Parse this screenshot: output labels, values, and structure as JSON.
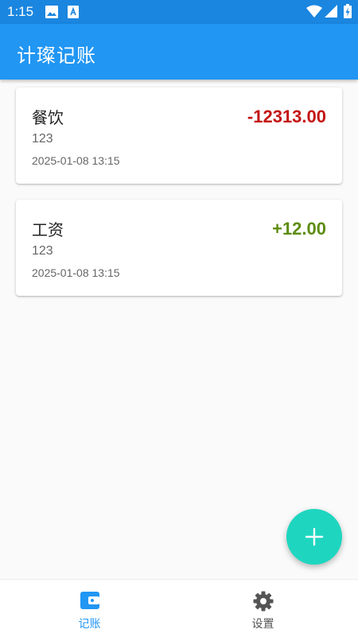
{
  "status_bar": {
    "time": "1:15"
  },
  "app_bar": {
    "title": "计璨记账"
  },
  "records": [
    {
      "category": "餐饮",
      "note": "123",
      "datetime": "2025-01-08 13:15",
      "amount": "-12313.00",
      "type": "expense"
    },
    {
      "category": "工资",
      "note": "123",
      "datetime": "2025-01-08 13:15",
      "amount": "+12.00",
      "type": "income"
    }
  ],
  "colors": {
    "primary": "#2196f3",
    "expense": "#c41414",
    "income": "#5d8c10",
    "fab": "#1ed6c0",
    "nav_active": "#2196f3",
    "nav_inactive": "#555555"
  },
  "fab": {
    "icon": "plus-icon"
  },
  "bottom_nav": {
    "items": [
      {
        "label": "记账",
        "icon": "wallet-icon",
        "active": true
      },
      {
        "label": "设置",
        "icon": "gear-icon",
        "active": false
      }
    ]
  }
}
